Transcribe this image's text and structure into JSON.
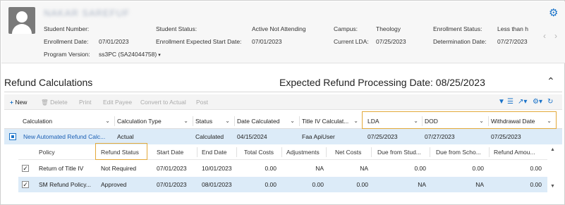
{
  "student": {
    "name": "NAKAR SAREFUF",
    "fields": {
      "student_number_label": "Student Number:",
      "enrollment_date_label": "Enrollment Date:",
      "enrollment_date": "07/01/2023",
      "program_version_label": "Program Version:",
      "program_version": "ss3PC (SA24044758)",
      "student_status_label": "Student Status:",
      "student_status": "Active Not Attending",
      "expected_start_label": "Enrollment Expected Start Date:",
      "expected_start": "07/01/2023",
      "campus_label": "Campus:",
      "campus": "Theology",
      "current_lda_label": "Current LDA:",
      "current_lda": "07/25/2023",
      "enrollment_status_label": "Enrollment Status:",
      "enrollment_status": "Less than h",
      "determination_date_label": "Determination Date:",
      "determination_date": "07/27/2023"
    }
  },
  "section": {
    "title": "Refund Calculations",
    "expected_processing": "Expected Refund Processing Date: 08/25/2023",
    "collapse_icon": "^"
  },
  "toolbar": {
    "new": "New",
    "delete": "Delete",
    "print": "Print",
    "edit_payee": "Edit Payee",
    "convert": "Convert to Actual",
    "post": "Post"
  },
  "grid": {
    "headers": [
      "Calculation",
      "Calculation Type",
      "Status",
      "Date Calculated",
      "Title IV Calculat...",
      "LDA",
      "DOD",
      "Withdrawal Date"
    ],
    "main_row": {
      "calculation": "New Automated Refund Calc...",
      "type": "Actual",
      "status": "Calculated",
      "date_calculated": "04/15/2024",
      "title_iv": "Faa ApiUser",
      "lda": "07/25/2023",
      "dod": "07/27/2023",
      "withdrawal": "07/25/2023"
    },
    "sub_headers": [
      "Policy",
      "Refund Status",
      "Start Date",
      "End Date",
      "Total Costs",
      "Adjustments",
      "Net Costs",
      "Due from Stud...",
      "Due from Scho...",
      "Refund Amou..."
    ],
    "sub_rows": [
      {
        "policy": "Return of Title IV",
        "status": "Not Required",
        "start": "07/01/2023",
        "end": "10/01/2023",
        "total": "0.00",
        "adjust": "NA",
        "net": "NA",
        "due_student": "0.00",
        "due_school": "0.00",
        "refund": "0.00"
      },
      {
        "policy": "SM Refund Policy...",
        "status": "Approved",
        "start": "07/01/2023",
        "end": "08/01/2023",
        "total": "0.00",
        "adjust": "0.00",
        "net": "0.00",
        "due_student": "NA",
        "due_school": "NA",
        "refund": "0.00"
      }
    ]
  },
  "colors": {
    "accent": "#1a73c9",
    "highlight": "#e3a93a",
    "selected_row": "#dcebf8"
  }
}
